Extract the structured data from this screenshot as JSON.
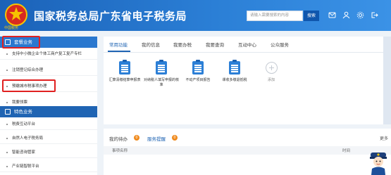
{
  "header": {
    "logo_text": "中国税务",
    "title": "国家税务总局广东省电子税务局",
    "search_placeholder": "请输入需要搜索的内容",
    "search_button": "搜索"
  },
  "sidebar": {
    "sections": [
      {
        "label": "套餐业务"
      },
      {
        "label": "特色业务"
      }
    ],
    "package_items": [
      {
        "label": "支持中小微企业个体工商户复工复产专栏"
      },
      {
        "label": "注销登记综合办理"
      },
      {
        "label": "预缴城市税事项办理"
      },
      {
        "label": "我要领票"
      }
    ],
    "feature_items": [
      {
        "label": "税费互动平台"
      },
      {
        "label": "自然人电子税务局"
      },
      {
        "label": "智能咨询管家"
      },
      {
        "label": "产业链智联平台"
      }
    ]
  },
  "main": {
    "tabs": [
      {
        "label": "常用功能"
      },
      {
        "label": "我的信息"
      },
      {
        "label": "我要办税"
      },
      {
        "label": "我要查询"
      },
      {
        "label": "互动中心"
      },
      {
        "label": "公众服务"
      }
    ],
    "quick_items": [
      {
        "label": "汇算清缴结算申报表"
      },
      {
        "label": "对纳税人填写申报的核准"
      },
      {
        "label": "不动产项目报告"
      },
      {
        "label": "课收多缴退抵税"
      },
      {
        "label": "添加"
      }
    ]
  },
  "bottom": {
    "tabs": [
      {
        "label": "我的待办",
        "count": "0"
      },
      {
        "label": "服务提醒",
        "count": "0"
      }
    ],
    "more_label": "更多",
    "columns": [
      "事项名称",
      "时间"
    ]
  },
  "colors": {
    "primary": "#1f64b3",
    "header_gradient_start": "#1b62b8",
    "header_gradient_end": "#3b92e6",
    "highlight": "#e02020",
    "badge": "#f08a1c"
  }
}
